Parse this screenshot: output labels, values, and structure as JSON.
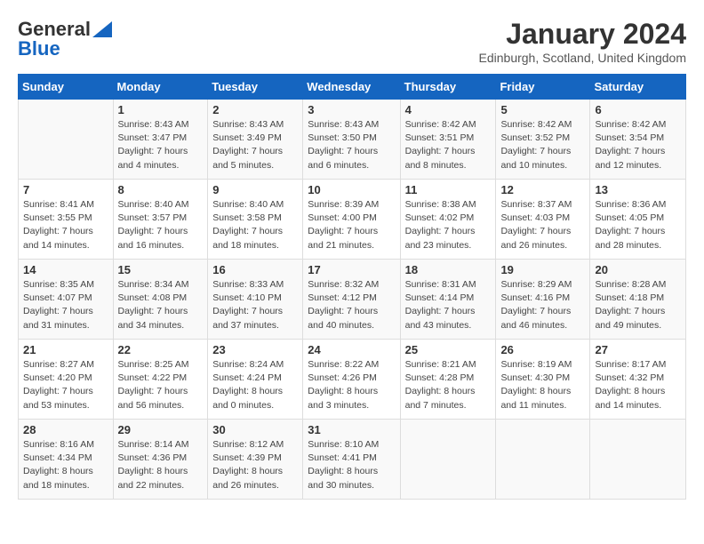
{
  "header": {
    "logo_line1": "General",
    "logo_line2": "Blue",
    "month_year": "January 2024",
    "location": "Edinburgh, Scotland, United Kingdom"
  },
  "days_of_week": [
    "Sunday",
    "Monday",
    "Tuesday",
    "Wednesday",
    "Thursday",
    "Friday",
    "Saturday"
  ],
  "weeks": [
    [
      {
        "num": "",
        "sunrise": "",
        "sunset": "",
        "daylight": ""
      },
      {
        "num": "1",
        "sunrise": "Sunrise: 8:43 AM",
        "sunset": "Sunset: 3:47 PM",
        "daylight": "Daylight: 7 hours and 4 minutes."
      },
      {
        "num": "2",
        "sunrise": "Sunrise: 8:43 AM",
        "sunset": "Sunset: 3:49 PM",
        "daylight": "Daylight: 7 hours and 5 minutes."
      },
      {
        "num": "3",
        "sunrise": "Sunrise: 8:43 AM",
        "sunset": "Sunset: 3:50 PM",
        "daylight": "Daylight: 7 hours and 6 minutes."
      },
      {
        "num": "4",
        "sunrise": "Sunrise: 8:42 AM",
        "sunset": "Sunset: 3:51 PM",
        "daylight": "Daylight: 7 hours and 8 minutes."
      },
      {
        "num": "5",
        "sunrise": "Sunrise: 8:42 AM",
        "sunset": "Sunset: 3:52 PM",
        "daylight": "Daylight: 7 hours and 10 minutes."
      },
      {
        "num": "6",
        "sunrise": "Sunrise: 8:42 AM",
        "sunset": "Sunset: 3:54 PM",
        "daylight": "Daylight: 7 hours and 12 minutes."
      }
    ],
    [
      {
        "num": "7",
        "sunrise": "Sunrise: 8:41 AM",
        "sunset": "Sunset: 3:55 PM",
        "daylight": "Daylight: 7 hours and 14 minutes."
      },
      {
        "num": "8",
        "sunrise": "Sunrise: 8:40 AM",
        "sunset": "Sunset: 3:57 PM",
        "daylight": "Daylight: 7 hours and 16 minutes."
      },
      {
        "num": "9",
        "sunrise": "Sunrise: 8:40 AM",
        "sunset": "Sunset: 3:58 PM",
        "daylight": "Daylight: 7 hours and 18 minutes."
      },
      {
        "num": "10",
        "sunrise": "Sunrise: 8:39 AM",
        "sunset": "Sunset: 4:00 PM",
        "daylight": "Daylight: 7 hours and 21 minutes."
      },
      {
        "num": "11",
        "sunrise": "Sunrise: 8:38 AM",
        "sunset": "Sunset: 4:02 PM",
        "daylight": "Daylight: 7 hours and 23 minutes."
      },
      {
        "num": "12",
        "sunrise": "Sunrise: 8:37 AM",
        "sunset": "Sunset: 4:03 PM",
        "daylight": "Daylight: 7 hours and 26 minutes."
      },
      {
        "num": "13",
        "sunrise": "Sunrise: 8:36 AM",
        "sunset": "Sunset: 4:05 PM",
        "daylight": "Daylight: 7 hours and 28 minutes."
      }
    ],
    [
      {
        "num": "14",
        "sunrise": "Sunrise: 8:35 AM",
        "sunset": "Sunset: 4:07 PM",
        "daylight": "Daylight: 7 hours and 31 minutes."
      },
      {
        "num": "15",
        "sunrise": "Sunrise: 8:34 AM",
        "sunset": "Sunset: 4:08 PM",
        "daylight": "Daylight: 7 hours and 34 minutes."
      },
      {
        "num": "16",
        "sunrise": "Sunrise: 8:33 AM",
        "sunset": "Sunset: 4:10 PM",
        "daylight": "Daylight: 7 hours and 37 minutes."
      },
      {
        "num": "17",
        "sunrise": "Sunrise: 8:32 AM",
        "sunset": "Sunset: 4:12 PM",
        "daylight": "Daylight: 7 hours and 40 minutes."
      },
      {
        "num": "18",
        "sunrise": "Sunrise: 8:31 AM",
        "sunset": "Sunset: 4:14 PM",
        "daylight": "Daylight: 7 hours and 43 minutes."
      },
      {
        "num": "19",
        "sunrise": "Sunrise: 8:29 AM",
        "sunset": "Sunset: 4:16 PM",
        "daylight": "Daylight: 7 hours and 46 minutes."
      },
      {
        "num": "20",
        "sunrise": "Sunrise: 8:28 AM",
        "sunset": "Sunset: 4:18 PM",
        "daylight": "Daylight: 7 hours and 49 minutes."
      }
    ],
    [
      {
        "num": "21",
        "sunrise": "Sunrise: 8:27 AM",
        "sunset": "Sunset: 4:20 PM",
        "daylight": "Daylight: 7 hours and 53 minutes."
      },
      {
        "num": "22",
        "sunrise": "Sunrise: 8:25 AM",
        "sunset": "Sunset: 4:22 PM",
        "daylight": "Daylight: 7 hours and 56 minutes."
      },
      {
        "num": "23",
        "sunrise": "Sunrise: 8:24 AM",
        "sunset": "Sunset: 4:24 PM",
        "daylight": "Daylight: 8 hours and 0 minutes."
      },
      {
        "num": "24",
        "sunrise": "Sunrise: 8:22 AM",
        "sunset": "Sunset: 4:26 PM",
        "daylight": "Daylight: 8 hours and 3 minutes."
      },
      {
        "num": "25",
        "sunrise": "Sunrise: 8:21 AM",
        "sunset": "Sunset: 4:28 PM",
        "daylight": "Daylight: 8 hours and 7 minutes."
      },
      {
        "num": "26",
        "sunrise": "Sunrise: 8:19 AM",
        "sunset": "Sunset: 4:30 PM",
        "daylight": "Daylight: 8 hours and 11 minutes."
      },
      {
        "num": "27",
        "sunrise": "Sunrise: 8:17 AM",
        "sunset": "Sunset: 4:32 PM",
        "daylight": "Daylight: 8 hours and 14 minutes."
      }
    ],
    [
      {
        "num": "28",
        "sunrise": "Sunrise: 8:16 AM",
        "sunset": "Sunset: 4:34 PM",
        "daylight": "Daylight: 8 hours and 18 minutes."
      },
      {
        "num": "29",
        "sunrise": "Sunrise: 8:14 AM",
        "sunset": "Sunset: 4:36 PM",
        "daylight": "Daylight: 8 hours and 22 minutes."
      },
      {
        "num": "30",
        "sunrise": "Sunrise: 8:12 AM",
        "sunset": "Sunset: 4:39 PM",
        "daylight": "Daylight: 8 hours and 26 minutes."
      },
      {
        "num": "31",
        "sunrise": "Sunrise: 8:10 AM",
        "sunset": "Sunset: 4:41 PM",
        "daylight": "Daylight: 8 hours and 30 minutes."
      },
      {
        "num": "",
        "sunrise": "",
        "sunset": "",
        "daylight": ""
      },
      {
        "num": "",
        "sunrise": "",
        "sunset": "",
        "daylight": ""
      },
      {
        "num": "",
        "sunrise": "",
        "sunset": "",
        "daylight": ""
      }
    ]
  ]
}
